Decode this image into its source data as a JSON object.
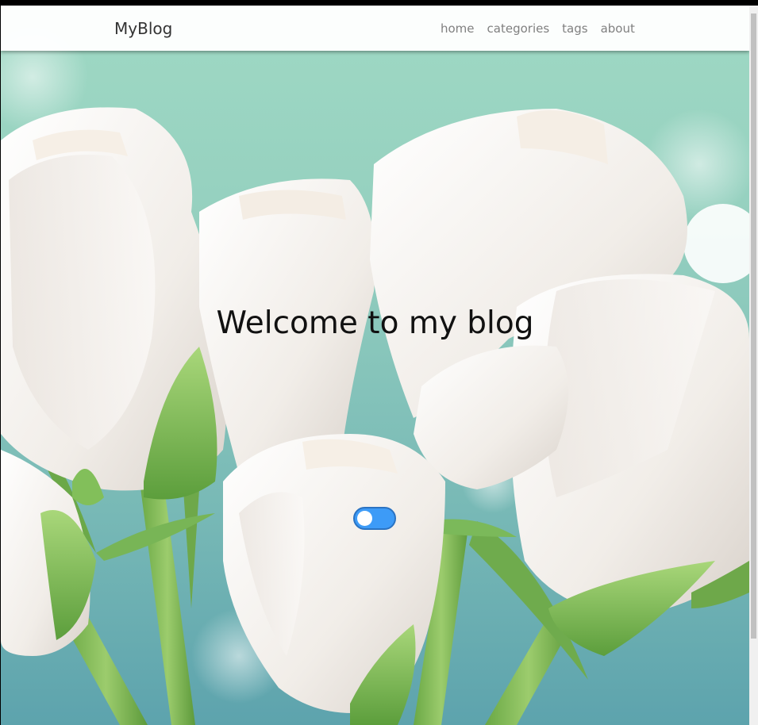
{
  "navbar": {
    "brand": "MyBlog",
    "links": [
      {
        "label": "home"
      },
      {
        "label": "categories"
      },
      {
        "label": "tags"
      },
      {
        "label": "about"
      }
    ]
  },
  "hero": {
    "heading": "Welcome to my blog",
    "background_image": "white-roses",
    "toggle_state": "on"
  },
  "colors": {
    "toggle_accent": "#3d9bf7",
    "navbar_bg": "#ffffff",
    "link_color": "#808080"
  }
}
